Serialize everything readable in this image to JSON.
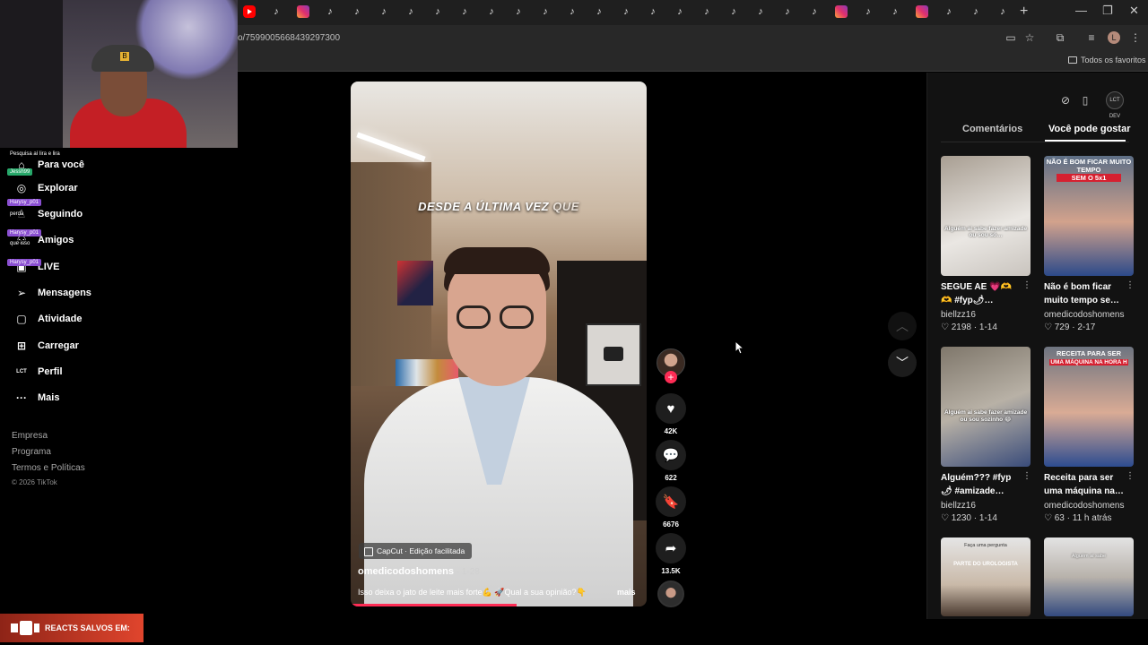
{
  "browser": {
    "url": "o/7599005668439297300",
    "tabs": [
      "youtube",
      "tiktok",
      "instagram",
      "tiktok",
      "tiktok",
      "tiktok",
      "tiktok",
      "tiktok",
      "tiktok",
      "tiktok",
      "tiktok",
      "tiktok",
      "tiktok",
      "tiktok",
      "tiktok",
      "tiktok",
      "tiktok",
      "tiktok",
      "tiktok",
      "tiktok",
      "tiktok",
      "tiktok",
      "instagram",
      "tiktok",
      "tiktok",
      "instagram",
      "tiktok",
      "tiktok",
      "tiktok"
    ],
    "new_tab": "+",
    "minimize": "—",
    "restore": "❐",
    "close": "✕",
    "profile_initial": "L",
    "bookmarks_label": "Todos os favoritos"
  },
  "overlay": {
    "chat": [
      {
        "text": "Pesquisa aí lira e lira"
      },
      {
        "text": "Jessh99"
      },
      {
        "text": "Harysy_p01"
      },
      {
        "text": "perda"
      },
      {
        "text": "Harysy_p01"
      },
      {
        "text": "que isso"
      },
      {
        "text": "Harysy_p01"
      }
    ],
    "reacts_label": "REACTS SALVOS EM:"
  },
  "sidebar": {
    "items": [
      {
        "label": "Para você",
        "icon": "home-icon"
      },
      {
        "label": "Explorar",
        "icon": "compass-icon"
      },
      {
        "label": "Seguindo",
        "icon": "following-icon"
      },
      {
        "label": "Amigos",
        "icon": "friends-icon"
      },
      {
        "label": "LIVE",
        "icon": "live-icon"
      },
      {
        "label": "Mensagens",
        "icon": "messages-icon"
      },
      {
        "label": "Atividade",
        "icon": "activity-icon"
      },
      {
        "label": "Carregar",
        "icon": "upload-icon"
      },
      {
        "label": "Perfil",
        "icon": "profile-icon"
      },
      {
        "label": "Mais",
        "icon": "more-icon"
      }
    ],
    "footer": [
      "Empresa",
      "Programa",
      "Termos e Políticas"
    ],
    "copyright": "© 2026 TikTok"
  },
  "video": {
    "caption_main": "DESDE A ÚLTIMA VEZ ",
    "caption_highlight": "QUE",
    "capcut_label": "CapCut · Edição facilitada",
    "author": "omedicodoshomens",
    "date": " · 1-28",
    "description": "Isso deixa o jato de leite mais forte💪 🚀Qual a sua opinião?👇",
    "more_label": "mais",
    "progress": 0.56
  },
  "actions": {
    "follow_plus": "+",
    "likes": "42K",
    "comments": "622",
    "saves": "6676",
    "shares": "13.5K"
  },
  "panel": {
    "tab_comments": "Comentários",
    "tab_suggested": "Você pode gostar",
    "avatar_text": "LCT DEV",
    "items": [
      {
        "title": "SEGUE AE 💗🫶 🫶 #fyp🌶…",
        "author": "biellzz16",
        "likes": "2198",
        "date": "1-14",
        "overlay": "Alguém ai sabe fazer amizade ou sou só…"
      },
      {
        "title": "Não é bom ficar muito tempo se…",
        "author": "omedicodoshomens",
        "likes": "729",
        "date": "2-17",
        "overlay": "NÃO É BOM FICAR MUITO TEMPO",
        "overlay2": "SEM O 5x1"
      },
      {
        "title": "Alguém??? #fyp🌶 #amizade…",
        "author": "biellzz16",
        "likes": "1230",
        "date": "1-14",
        "overlay": "Alguém ai sabe fazer amizade ou sou sozinho 😂"
      },
      {
        "title": "Receita para ser uma máquina na…",
        "author": "omedicodoshomens",
        "likes": "63",
        "date": "11 h atrás",
        "overlay": "RECEITA PARA SER",
        "overlay2": "UMA MÁQUINA NA HORA H"
      },
      {
        "title": "",
        "author": "",
        "likes": "",
        "date": "",
        "overlay": "Faça uma pergunta",
        "overlay2": "PARTE DO UROLOGISTA"
      },
      {
        "title": "",
        "author": "",
        "likes": "",
        "date": "",
        "overlay": "Alguém aí sabe"
      }
    ]
  },
  "colors": {
    "accent": "#fe2c55",
    "background": "#000000",
    "panel": "#121212"
  }
}
